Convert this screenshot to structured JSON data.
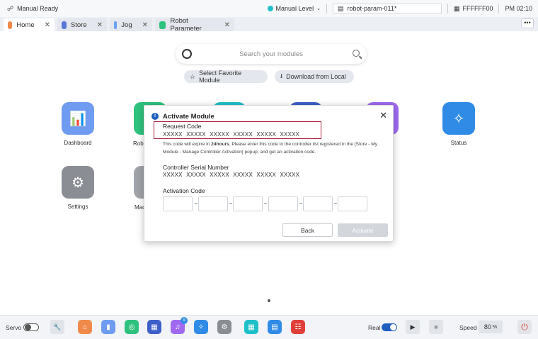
{
  "status_bar": {
    "mode": "Manual Ready",
    "level": "Manual Level",
    "param_file": "robot-param-011*",
    "color_code": "FFFFFF00",
    "time": "PM 02:10"
  },
  "tabs": [
    {
      "label": "Home",
      "icon": "home-icon",
      "color": "#f08a4b"
    },
    {
      "label": "Store",
      "icon": "store-icon",
      "color": "#5a78d8"
    },
    {
      "label": "Jog",
      "icon": "jog-icon",
      "color": "#6aa0f0"
    },
    {
      "label": "Robot Parameter",
      "icon": "parameter-icon",
      "color": "#2ec27e"
    }
  ],
  "tab_more": "•••",
  "search": {
    "placeholder": "Search your modules"
  },
  "pills": {
    "favorite": "Select Favorite Module",
    "download": "Download from Local"
  },
  "apps": {
    "dashboard": "Dashboard",
    "robot_partial": "Rob",
    "status": "Status",
    "settings": "Settings",
    "mac_partial": "Mac"
  },
  "modal": {
    "title": "Activate Module",
    "request_code_label": "Request Code",
    "request_code": "XXXXX  XXXXX  XXXXX  XXXXX  XXXXX  XXXXX",
    "desc_pre": "This code will expire in ",
    "desc_bold": "24hours",
    "desc_post": ". Please enter this code to the controller list registered in the [Store - My Module - Manage Controller Activation] popup, and get an activation code.",
    "serial_label": "Controller Serial Number",
    "serial": "XXXXX  XXXXX  XXXXX  XXXXX  XXXXX  XXXXX",
    "activation_label": "Activation Code",
    "back": "Back",
    "activate": "Activate"
  },
  "bottom_bar": {
    "servo": "Servo",
    "real": "Real",
    "speed_label": "Speed",
    "speed_value": "80",
    "speed_unit": "%",
    "notification_count": "9"
  },
  "colors": {
    "accent_blue": "#1f5fbf",
    "highlight_border": "#a8203c"
  }
}
